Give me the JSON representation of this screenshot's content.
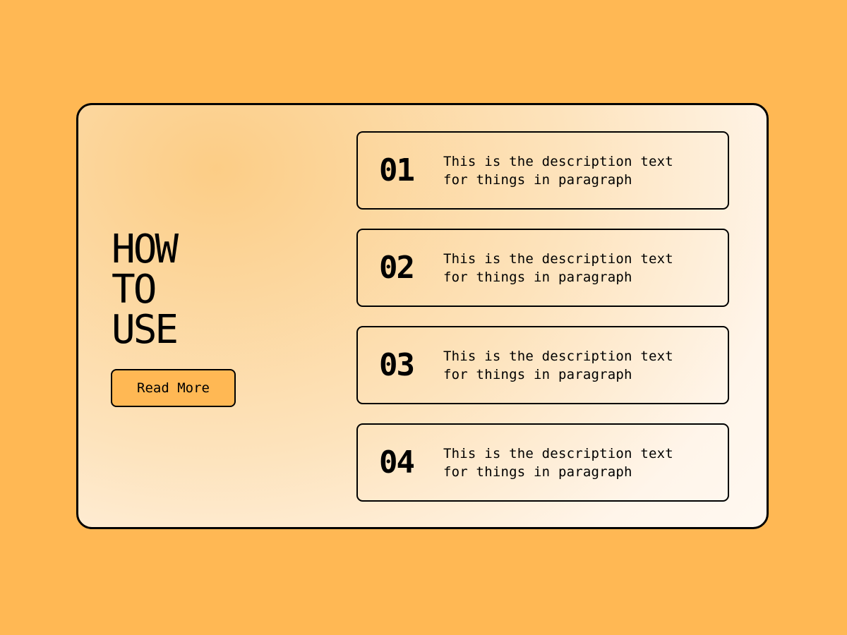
{
  "heading": {
    "line1": "HOW",
    "line2": "TO",
    "line3": "USE"
  },
  "button": {
    "label": "Read More"
  },
  "steps": [
    {
      "number": "01",
      "line1": "This is the description text",
      "line2": "for things in paragraph"
    },
    {
      "number": "02",
      "line1": "This is the description text",
      "line2": "for things in paragraph"
    },
    {
      "number": "03",
      "line1": "This is the description text",
      "line2": "for things in paragraph"
    },
    {
      "number": "04",
      "line1": "This is the description text",
      "line2": "for things in paragraph"
    }
  ],
  "colors": {
    "background": "#FFB854",
    "accent": "#FFB854",
    "border": "#000000"
  }
}
